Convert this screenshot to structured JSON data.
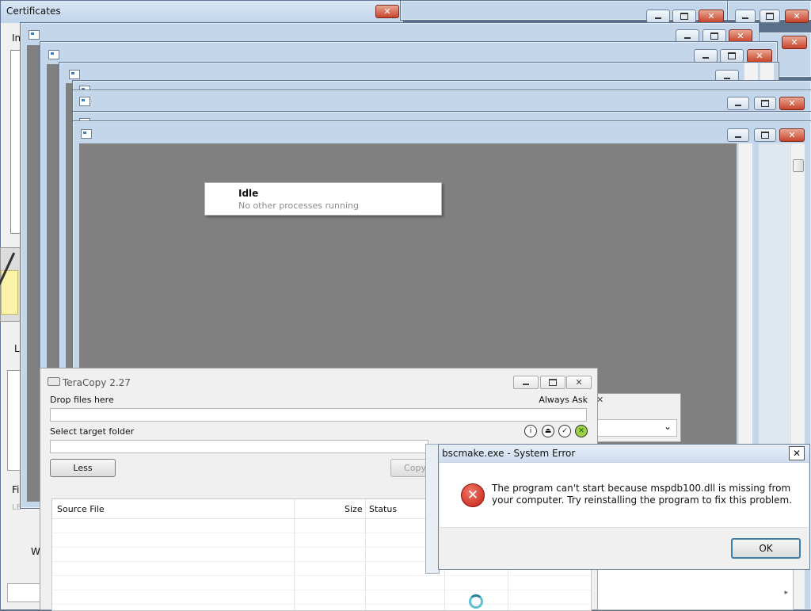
{
  "certificates_window": {
    "title": "Certificates",
    "fragment_in": "In",
    "fragment_l": "Le",
    "fragment_fi": "Fi",
    "fragment_le": "LE",
    "fragment_w": "W"
  },
  "tooltip": {
    "title": "Idle",
    "subtitle": "No other processes running"
  },
  "teracopy": {
    "title": "TeraCopy 2.27",
    "drop_label": "Drop files here",
    "always_ask": "Always Ask",
    "target_label": "Select target folder",
    "less_button": "Less",
    "copy_button": "Copy",
    "columns": [
      "Source File",
      "Size",
      "Status"
    ],
    "status_icons": [
      "info-icon",
      "eject-icon",
      "check-icon",
      "cancel-icon"
    ]
  },
  "error_dialog": {
    "title": "bscmake.exe - System Error",
    "message": "The program can't start because mspdb100.dll is missing from your computer. Try reinstalling the program to fix this problem.",
    "ok_button": "OK"
  },
  "colors": {
    "desktop": "#5a6f88",
    "title_gradient": "#c3d6ea",
    "close_red": "#c8432b",
    "gray_client": "#808080"
  }
}
